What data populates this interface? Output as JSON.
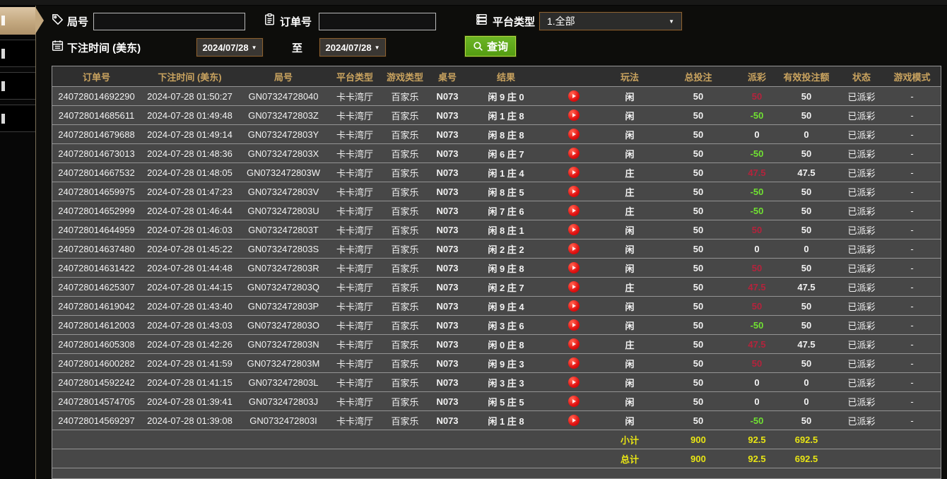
{
  "filters": {
    "game_no_label": "局号",
    "order_no_label": "订单号",
    "platform_label": "平台类型",
    "platform_value": "1.全部",
    "bet_time_label": "下注时间 (美东)",
    "date_from": "2024/07/28",
    "date_to": "2024/07/28",
    "to_label": "至",
    "query_label": "查询"
  },
  "icons": {
    "game_no": "tag-icon",
    "order_no": "clipboard-icon",
    "platform": "list-icon",
    "bet_time": "calendar-icon",
    "query": "search-icon",
    "row_action": "play-icon"
  },
  "colors": {
    "header_gold": "#c9a35f",
    "payout_positive_red": "#b5233c",
    "payout_negative_green": "#70e132",
    "total_yellow": "#e8e514",
    "status_green": "#45e045",
    "query_button_green": "#549c12",
    "active_tab_tan": "#c3a87f",
    "row_bg": "#474747"
  },
  "sidebar": {
    "tabs": [
      {
        "state": "active"
      },
      {
        "state": "default"
      },
      {
        "state": "default"
      },
      {
        "state": "default"
      }
    ]
  },
  "table": {
    "columns": [
      "订单号",
      "下注时间 (美东)",
      "局号",
      "平台类型",
      "游戏类型",
      "桌号",
      "结果",
      "玩法",
      "总投注",
      "派彩",
      "有效投注额",
      "状态",
      "游戏模式"
    ],
    "rows": [
      {
        "order": "240728014692290",
        "time": "2024-07-28 01:50:27",
        "game_no": "GN07324728040",
        "platform": "卡卡湾厅",
        "game_type": "百家乐",
        "table_no": "N073",
        "result": "闲 9 庄 0",
        "play_type": "闲",
        "total_bet": "50",
        "payout": "50",
        "payout_class": "pos",
        "valid_bet": "50",
        "status": "已派彩",
        "mode": "-"
      },
      {
        "order": "240728014685611",
        "time": "2024-07-28 01:49:48",
        "game_no": "GN0732472803Z",
        "platform": "卡卡湾厅",
        "game_type": "百家乐",
        "table_no": "N073",
        "result": "闲 1 庄 8",
        "play_type": "闲",
        "total_bet": "50",
        "payout": "-50",
        "payout_class": "neg",
        "valid_bet": "50",
        "status": "已派彩",
        "mode": "-"
      },
      {
        "order": "240728014679688",
        "time": "2024-07-28 01:49:14",
        "game_no": "GN0732472803Y",
        "platform": "卡卡湾厅",
        "game_type": "百家乐",
        "table_no": "N073",
        "result": "闲 8 庄 8",
        "play_type": "闲",
        "total_bet": "50",
        "payout": "0",
        "payout_class": "zero",
        "valid_bet": "0",
        "status": "已派彩",
        "mode": "-"
      },
      {
        "order": "240728014673013",
        "time": "2024-07-28 01:48:36",
        "game_no": "GN0732472803X",
        "platform": "卡卡湾厅",
        "game_type": "百家乐",
        "table_no": "N073",
        "result": "闲 6 庄 7",
        "play_type": "闲",
        "total_bet": "50",
        "payout": "-50",
        "payout_class": "neg",
        "valid_bet": "50",
        "status": "已派彩",
        "mode": "-"
      },
      {
        "order": "240728014667532",
        "time": "2024-07-28 01:48:05",
        "game_no": "GN0732472803W",
        "platform": "卡卡湾厅",
        "game_type": "百家乐",
        "table_no": "N073",
        "result": "闲 1 庄 4",
        "play_type": "庄",
        "total_bet": "50",
        "payout": "47.5",
        "payout_class": "pos",
        "valid_bet": "47.5",
        "status": "已派彩",
        "mode": "-"
      },
      {
        "order": "240728014659975",
        "time": "2024-07-28 01:47:23",
        "game_no": "GN0732472803V",
        "platform": "卡卡湾厅",
        "game_type": "百家乐",
        "table_no": "N073",
        "result": "闲 8 庄 5",
        "play_type": "庄",
        "total_bet": "50",
        "payout": "-50",
        "payout_class": "neg",
        "valid_bet": "50",
        "status": "已派彩",
        "mode": "-"
      },
      {
        "order": "240728014652999",
        "time": "2024-07-28 01:46:44",
        "game_no": "GN0732472803U",
        "platform": "卡卡湾厅",
        "game_type": "百家乐",
        "table_no": "N073",
        "result": "闲 7 庄 6",
        "play_type": "庄",
        "total_bet": "50",
        "payout": "-50",
        "payout_class": "neg",
        "valid_bet": "50",
        "status": "已派彩",
        "mode": "-"
      },
      {
        "order": "240728014644959",
        "time": "2024-07-28 01:46:03",
        "game_no": "GN0732472803T",
        "platform": "卡卡湾厅",
        "game_type": "百家乐",
        "table_no": "N073",
        "result": "闲 8 庄 1",
        "play_type": "闲",
        "total_bet": "50",
        "payout": "50",
        "payout_class": "pos",
        "valid_bet": "50",
        "status": "已派彩",
        "mode": "-"
      },
      {
        "order": "240728014637480",
        "time": "2024-07-28 01:45:22",
        "game_no": "GN0732472803S",
        "platform": "卡卡湾厅",
        "game_type": "百家乐",
        "table_no": "N073",
        "result": "闲 2 庄 2",
        "play_type": "闲",
        "total_bet": "50",
        "payout": "0",
        "payout_class": "zero",
        "valid_bet": "0",
        "status": "已派彩",
        "mode": "-"
      },
      {
        "order": "240728014631422",
        "time": "2024-07-28 01:44:48",
        "game_no": "GN0732472803R",
        "platform": "卡卡湾厅",
        "game_type": "百家乐",
        "table_no": "N073",
        "result": "闲 9 庄 8",
        "play_type": "闲",
        "total_bet": "50",
        "payout": "50",
        "payout_class": "pos",
        "valid_bet": "50",
        "status": "已派彩",
        "mode": "-"
      },
      {
        "order": "240728014625307",
        "time": "2024-07-28 01:44:15",
        "game_no": "GN0732472803Q",
        "platform": "卡卡湾厅",
        "game_type": "百家乐",
        "table_no": "N073",
        "result": "闲 2 庄 7",
        "play_type": "庄",
        "total_bet": "50",
        "payout": "47.5",
        "payout_class": "pos",
        "valid_bet": "47.5",
        "status": "已派彩",
        "mode": "-"
      },
      {
        "order": "240728014619042",
        "time": "2024-07-28 01:43:40",
        "game_no": "GN0732472803P",
        "platform": "卡卡湾厅",
        "game_type": "百家乐",
        "table_no": "N073",
        "result": "闲 9 庄 4",
        "play_type": "闲",
        "total_bet": "50",
        "payout": "50",
        "payout_class": "pos",
        "valid_bet": "50",
        "status": "已派彩",
        "mode": "-"
      },
      {
        "order": "240728014612003",
        "time": "2024-07-28 01:43:03",
        "game_no": "GN0732472803O",
        "platform": "卡卡湾厅",
        "game_type": "百家乐",
        "table_no": "N073",
        "result": "闲 3 庄 6",
        "play_type": "闲",
        "total_bet": "50",
        "payout": "-50",
        "payout_class": "neg",
        "valid_bet": "50",
        "status": "已派彩",
        "mode": "-"
      },
      {
        "order": "240728014605308",
        "time": "2024-07-28 01:42:26",
        "game_no": "GN0732472803N",
        "platform": "卡卡湾厅",
        "game_type": "百家乐",
        "table_no": "N073",
        "result": "闲 0 庄 8",
        "play_type": "庄",
        "total_bet": "50",
        "payout": "47.5",
        "payout_class": "pos",
        "valid_bet": "47.5",
        "status": "已派彩",
        "mode": "-"
      },
      {
        "order": "240728014600282",
        "time": "2024-07-28 01:41:59",
        "game_no": "GN0732472803M",
        "platform": "卡卡湾厅",
        "game_type": "百家乐",
        "table_no": "N073",
        "result": "闲 9 庄 3",
        "play_type": "闲",
        "total_bet": "50",
        "payout": "50",
        "payout_class": "pos",
        "valid_bet": "50",
        "status": "已派彩",
        "mode": "-"
      },
      {
        "order": "240728014592242",
        "time": "2024-07-28 01:41:15",
        "game_no": "GN0732472803L",
        "platform": "卡卡湾厅",
        "game_type": "百家乐",
        "table_no": "N073",
        "result": "闲 3 庄 3",
        "play_type": "闲",
        "total_bet": "50",
        "payout": "0",
        "payout_class": "zero",
        "valid_bet": "0",
        "status": "已派彩",
        "mode": "-"
      },
      {
        "order": "240728014574705",
        "time": "2024-07-28 01:39:41",
        "game_no": "GN0732472803J",
        "platform": "卡卡湾厅",
        "game_type": "百家乐",
        "table_no": "N073",
        "result": "闲 5 庄 5",
        "play_type": "闲",
        "total_bet": "50",
        "payout": "0",
        "payout_class": "zero",
        "valid_bet": "0",
        "status": "已派彩",
        "mode": "-"
      },
      {
        "order": "240728014569297",
        "time": "2024-07-28 01:39:08",
        "game_no": "GN0732472803I",
        "platform": "卡卡湾厅",
        "game_type": "百家乐",
        "table_no": "N073",
        "result": "闲 1 庄 8",
        "play_type": "闲",
        "total_bet": "50",
        "payout": "-50",
        "payout_class": "neg",
        "valid_bet": "50",
        "status": "已派彩",
        "mode": "-"
      }
    ],
    "subtotal": {
      "label": "小计",
      "total_bet": "900",
      "payout": "92.5",
      "valid_bet": "692.5"
    },
    "total": {
      "label": "总计",
      "total_bet": "900",
      "payout": "92.5",
      "valid_bet": "692.5"
    }
  }
}
